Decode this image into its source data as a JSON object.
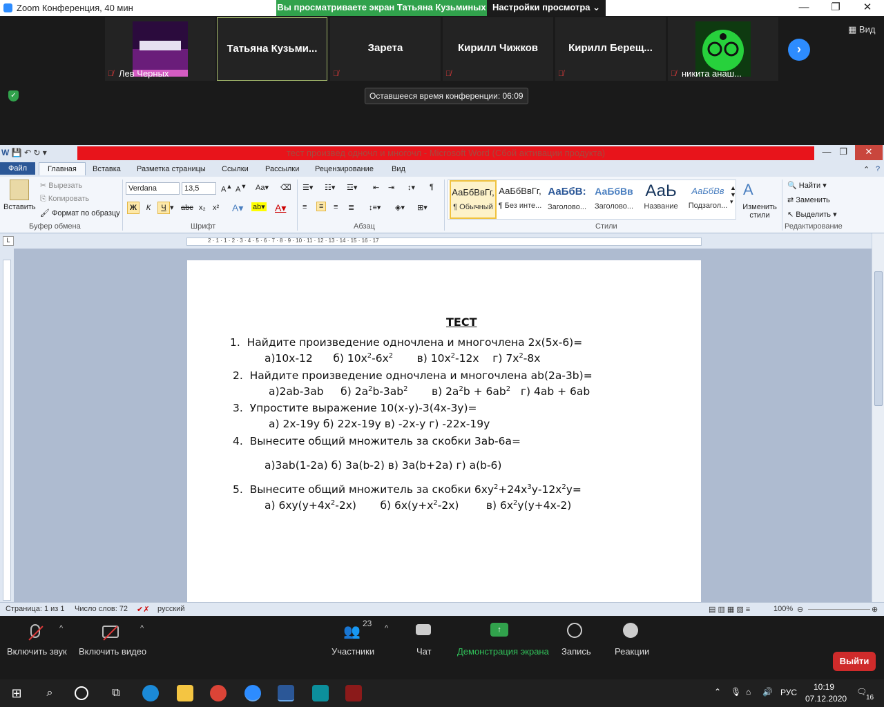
{
  "zoom": {
    "window_title": "Zoom Конференция, 40 мин",
    "share_banner": "Вы просматриваете экран Татьяна Кузьминых",
    "view_options": "Настройки просмотра",
    "gallery_label": "Вид",
    "remaining_time": "Оставшееся время конференции: 06:09",
    "participants": [
      {
        "name": "Лев Черных",
        "has_video": true
      },
      {
        "name": "Татьяна  Кузьми...",
        "active": true
      },
      {
        "name": "Зарета"
      },
      {
        "name": "Кирилл Чижков"
      },
      {
        "name": "Кирилл  Берещ..."
      },
      {
        "name": "никита анаш...",
        "has_video": true
      }
    ],
    "controls": {
      "audio": "Включить звук",
      "video": "Включить видео",
      "participants_label": "Участники",
      "participants_count": "23",
      "chat": "Чат",
      "share": "Демонстрация экрана",
      "record": "Запись",
      "reactions": "Реакции",
      "leave": "Выйти"
    }
  },
  "word": {
    "window_title": "тест произвед одночл и многочл - Microsoft Word (Сбой активации продукта)",
    "tabs": [
      "Файл",
      "Главная",
      "Вставка",
      "Разметка страницы",
      "Ссылки",
      "Рассылки",
      "Рецензирование",
      "Вид"
    ],
    "clipboard": {
      "paste": "Вставить",
      "cut": "Вырезать",
      "copy": "Копировать",
      "format_painter": "Формат по образцу",
      "group": "Буфер обмена"
    },
    "font": {
      "name": "Verdana",
      "size": "13,5",
      "group": "Шрифт",
      "bold": "Ж",
      "italic": "К",
      "underline": "Ч"
    },
    "paragraph": {
      "group": "Абзац"
    },
    "styles": {
      "group": "Стили",
      "items": [
        {
          "preview": "АаБбВвГг,",
          "name": "¶ Обычный"
        },
        {
          "preview": "АаБбВвГг,",
          "name": "¶ Без инте..."
        },
        {
          "preview": "АаБбВ:",
          "name": "Заголово..."
        },
        {
          "preview": "АаБбВв",
          "name": "Заголово..."
        },
        {
          "preview": "АаЬ",
          "name": "Название"
        },
        {
          "preview": "АаБбВв",
          "name": "Подзагол..."
        }
      ],
      "change": "Изменить стили"
    },
    "editing": {
      "group": "Редактирование",
      "find": "Найти",
      "replace": "Заменить",
      "select": "Выделить"
    },
    "document": {
      "title": "ТЕСТ",
      "q1_text": "Найдите произведение одночлена и многочлена 2х(5х-6)=",
      "q2_text": "Найдите произведение одночлена и многочлена   ab(2a-3b)=",
      "q3_text": "Упростите выражение 10(х-у)-3(4х-3у)=",
      "q3_answers": "а) 2х-19у       б) 22х-19у       в) -2х-у        г) -22х-19у",
      "q4_text": "Вынесите общий множитель за скобки 3ab-6a=",
      "q4_answers": "а)3ab(1-2a)      б) 3a(b-2)       в) 3a(b+2a)       г) a(b-6)",
      "q5_text_a": "Вынесите общий множитель за скобки 6ху",
      "q5_text_b": "+24х",
      "q5_text_c": "у-12х",
      "q5_text_d": "у="
    },
    "status": {
      "page": "Страница: 1 из 1",
      "words": "Число слов: 72",
      "language": "русский",
      "zoom": "100%"
    }
  },
  "taskbar": {
    "lang": "РУС",
    "time": "10:19",
    "date": "07.12.2020",
    "notifications": "16"
  }
}
